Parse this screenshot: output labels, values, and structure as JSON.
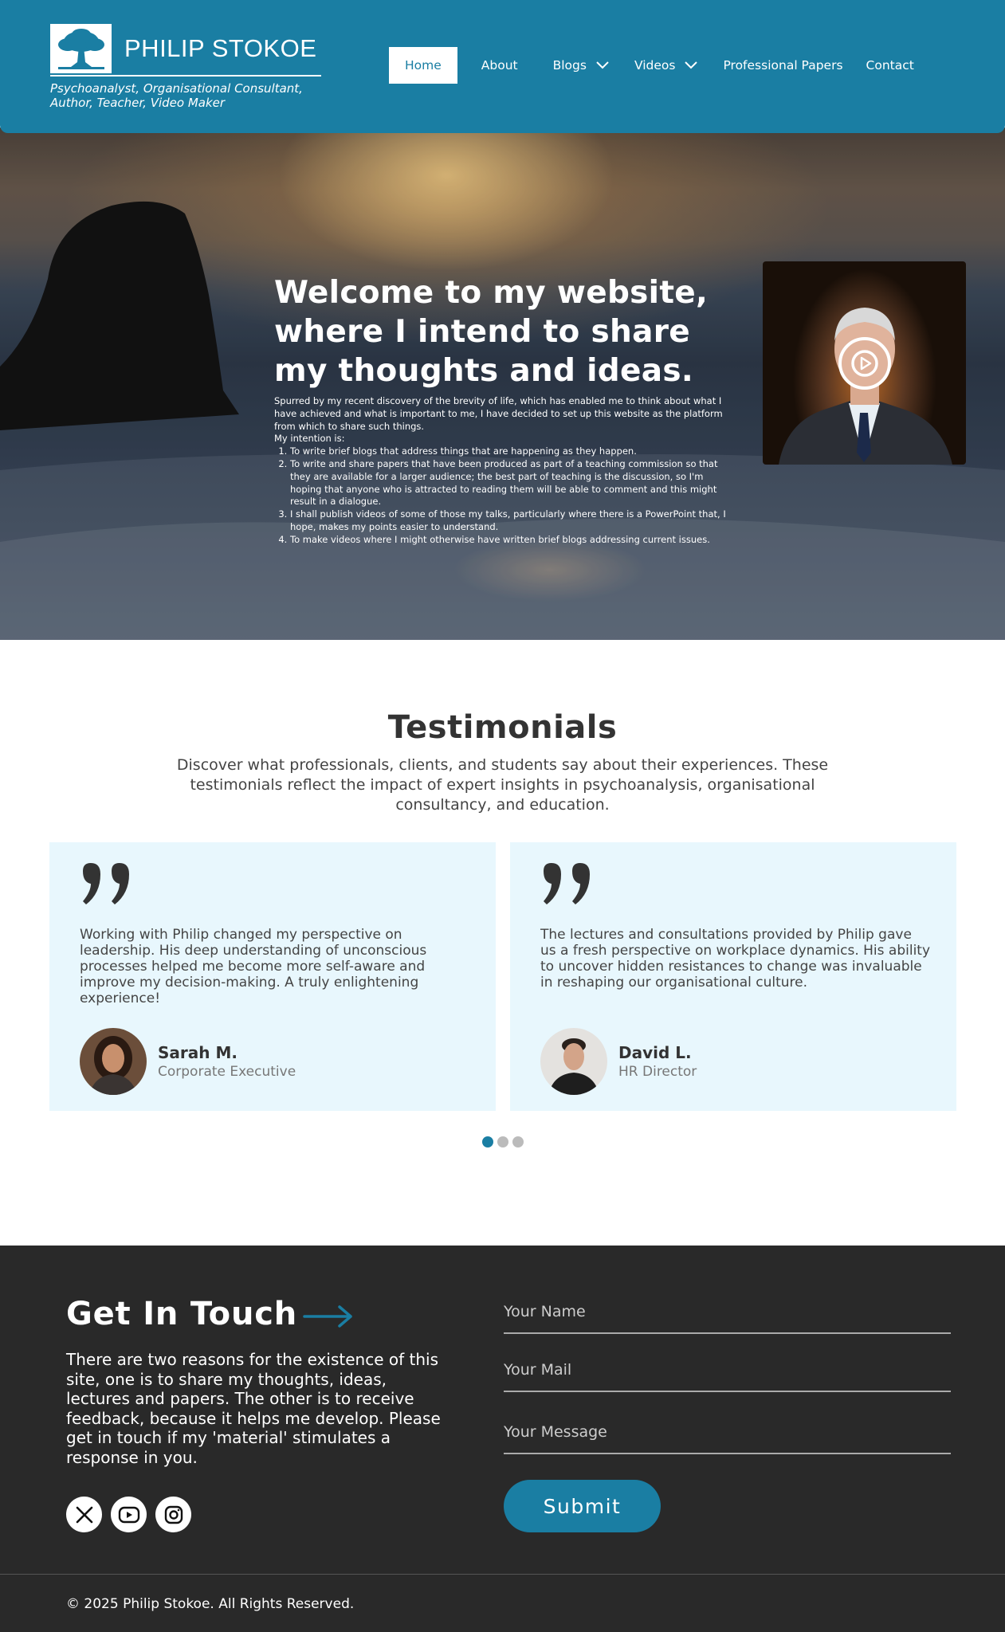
{
  "header": {
    "logo_name": "PHILIP STOKOE",
    "tagline_line1": "Psychoanalyst, Organisational Consultant,",
    "tagline_line2": "Author, Teacher, Video Maker",
    "nav": {
      "home": "Home",
      "about": "About",
      "blogs": "Blogs",
      "videos": "Videos",
      "papers": "Professional Papers",
      "contact": "Contact"
    }
  },
  "hero": {
    "title": "Welcome to my website, where I intend to share my thoughts and ideas.",
    "intro": "Spurred by my recent discovery of the brevity of life, which has enabled me to think about what I have achieved and what is important to me, I have decided to set up this website as the platform from which to share such things.",
    "intention_label": "My intention is:",
    "items": [
      "To write brief blogs that address things that are happening as they happen.",
      "To write and share papers that have been produced as part of a teaching commission so that they are available for a larger audience; the best part of teaching is the discussion, so I'm hoping that anyone who is attracted to reading them will be able to comment and this might result in a dialogue.",
      "I shall publish videos of some of those my talks, particularly where there is a PowerPoint that, I hope, makes my points easier to understand.",
      "To make videos where I might otherwise have written brief blogs addressing current issues."
    ]
  },
  "testimonials": {
    "title": "Testimonials",
    "subtitle": "Discover what professionals, clients, and students say about their experiences. These testimonials reflect the impact of expert insights in psychoanalysis, organisational consultancy, and education.",
    "cards": [
      {
        "text": "Working with Philip changed my perspective on leadership. His deep understanding of unconscious processes helped me become more self-aware and improve my decision-making. A truly enlightening experience!",
        "name": "Sarah M.",
        "role": "Corporate Executive"
      },
      {
        "text": "The lectures and consultations provided by Philip gave us a fresh perspective on workplace dynamics. His ability to uncover hidden resistances to change was invaluable in reshaping our organisational culture.",
        "name": "David L.",
        "role": "HR Director"
      }
    ],
    "active_dot": 1,
    "dot_count": 3
  },
  "contact": {
    "title": "Get In Touch",
    "text": "There are two reasons for the existence of this site, one is to share my thoughts, ideas, lectures and papers. The other is to receive feedback, because it helps me develop. Please get in touch if my 'material' stimulates a response in you.",
    "name_placeholder": "Your Name",
    "mail_placeholder": "Your Mail",
    "message_placeholder": "Your Message",
    "submit_label": "Submit",
    "socials": [
      "x-icon",
      "youtube-icon",
      "instagram-icon"
    ]
  },
  "footer": {
    "copyright": "© 2025 Philip Stokoe. All Rights Reserved."
  },
  "colors": {
    "brand": "#1a7ea3",
    "card_bg": "#e8f7fd",
    "footer_bg": "#292929"
  }
}
